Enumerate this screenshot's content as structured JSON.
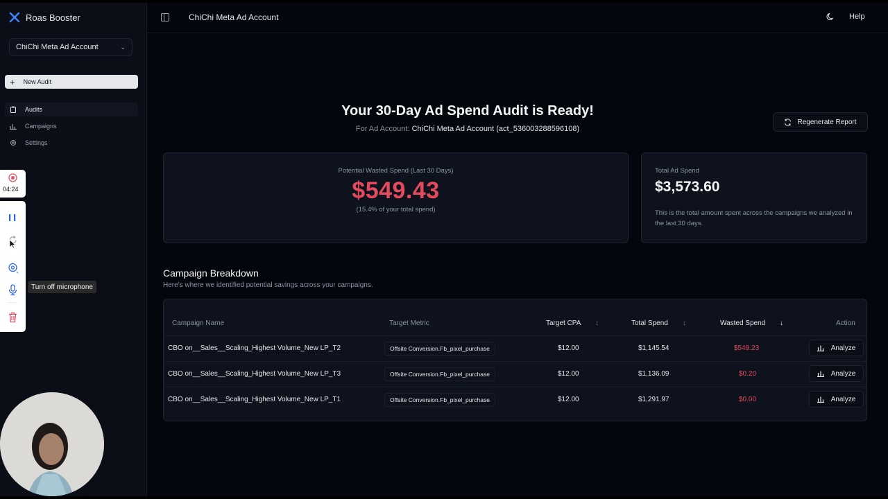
{
  "app": {
    "name": "Roas Booster"
  },
  "sidebar": {
    "account_select": "ChiChi Meta Ad Account",
    "new_audit": "New Audit",
    "items": [
      {
        "label": "Audits",
        "icon": "clipboard-icon",
        "active": true
      },
      {
        "label": "Campaigns",
        "icon": "bar-chart-icon",
        "active": false
      },
      {
        "label": "Settings",
        "icon": "gear-icon",
        "active": false
      }
    ]
  },
  "recorder": {
    "time": "04:24",
    "tooltip": "Turn off microphone"
  },
  "topbar": {
    "title": "ChiChi Meta Ad Account",
    "help": "Help"
  },
  "main": {
    "headline": "Your 30-Day Ad Spend Audit is Ready!",
    "sub_prefix": "For Ad Account:",
    "sub_account": "ChiChi Meta Ad Account (act_536003288596108)",
    "regenerate": "Regenerate Report"
  },
  "wasted": {
    "label": "Potential Wasted Spend (Last 30 Days)",
    "value": "$549.43",
    "pct": "(15.4% of your total spend)"
  },
  "total": {
    "label": "Total Ad Spend",
    "value": "$3,573.60",
    "desc": "This is the total amount spent across the campaigns we analyzed in the last 30 days."
  },
  "breakdown": {
    "title": "Campaign Breakdown",
    "subtitle": "Here's where we identified potential savings across your campaigns.",
    "headers": {
      "name": "Campaign Name",
      "metric": "Target Metric",
      "cpa": "Target CPA",
      "spend": "Total Spend",
      "wasted": "Wasted Spend",
      "action": "Action"
    },
    "analyze_label": "Analyze",
    "rows": [
      {
        "name": "CBO on__Sales__Scaling_Highest Volume_New LP_T2",
        "metric": "Offsite Conversion.Fb_pixel_purchase",
        "cpa": "$12.00",
        "spend": "$1,145.54",
        "wasted": "$549.23"
      },
      {
        "name": "CBO on__Sales__Scaling_Highest Volume_New LP_T3",
        "metric": "Offsite Conversion.Fb_pixel_purchase",
        "cpa": "$12.00",
        "spend": "$1,136.09",
        "wasted": "$0.20"
      },
      {
        "name": "CBO on__Sales__Scaling_Highest Volume_New LP_T1",
        "metric": "Offsite Conversion.Fb_pixel_purchase",
        "cpa": "$12.00",
        "spend": "$1,291.97",
        "wasted": "$0.00"
      }
    ]
  },
  "colors": {
    "accent_red": "#e44a5e",
    "background": "#04060d",
    "card": "#0e121c"
  }
}
